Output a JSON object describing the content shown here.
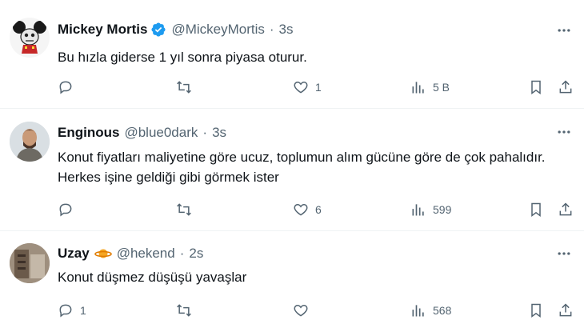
{
  "colors": {
    "accent": "#1d9bf0",
    "text": "#0f1419",
    "muted": "#536471",
    "divider": "#eff3f4"
  },
  "tweets": [
    {
      "name": "Mickey Mortis",
      "verified": true,
      "handle": "@MickeyMortis",
      "time": "3s",
      "text": "Bu hızla giderse 1 yıl sonra piyasa oturur.",
      "reply_count": "",
      "retweet_count": "",
      "like_count": "1",
      "view_count": "5 B"
    },
    {
      "name": "Enginous",
      "handle": "@blue0dark",
      "time": "3s",
      "text": "Konut fiyatları maliyetine göre ucuz, toplumun alım gücüne göre de çok pahalıdır. Herkes işine geldiği gibi görmek ister",
      "reply_count": "",
      "retweet_count": "",
      "like_count": "6",
      "view_count": "599"
    },
    {
      "name": "Uzay",
      "handle": "@hekend",
      "time": "2s",
      "text": "Konut düşmez düşüşü yavaşlar",
      "reply_count": "1",
      "retweet_count": "",
      "like_count": "",
      "view_count": "568"
    }
  ],
  "icons": [
    "more-icon",
    "reply-icon",
    "retweet-icon",
    "like-icon",
    "views-icon",
    "bookmark-icon",
    "share-icon",
    "verified-icon",
    "planet-emoji-icon"
  ]
}
